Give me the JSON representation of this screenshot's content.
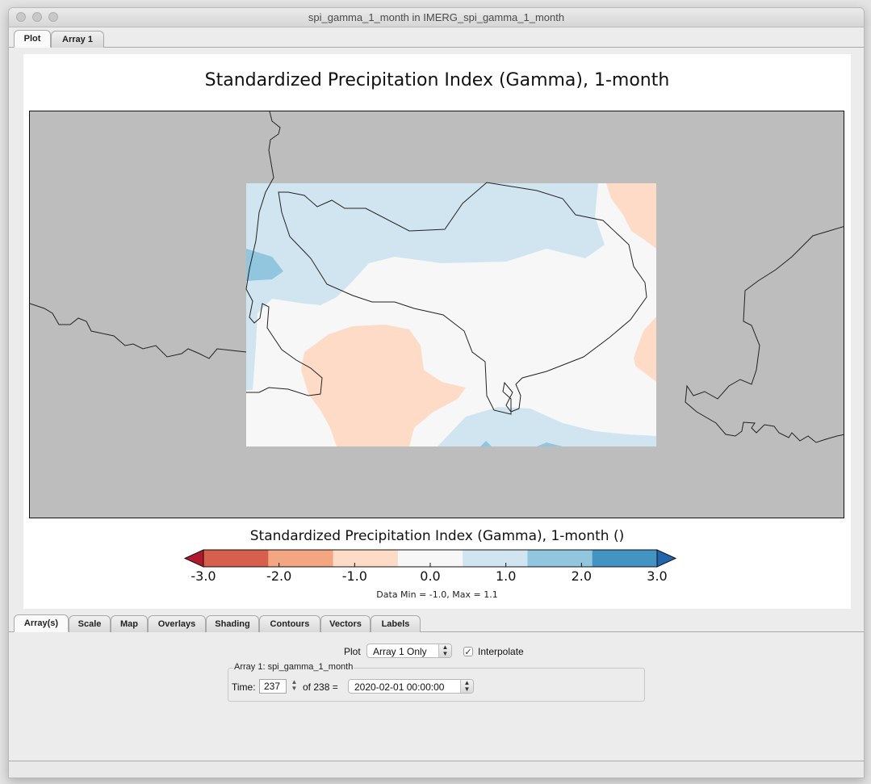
{
  "window": {
    "title": "spi_gamma_1_month in IMERG_spi_gamma_1_month"
  },
  "top_tabs": [
    {
      "label": "Plot",
      "active": true
    },
    {
      "label": "Array 1",
      "active": false
    }
  ],
  "plot": {
    "title": "Standardized Precipitation Index (Gamma), 1-month",
    "colorbar": {
      "title": "Standardized Precipitation Index (Gamma), 1-month ()",
      "ticks": [
        "-3.0",
        "-2.0",
        "-1.0",
        "0.0",
        "1.0",
        "2.0",
        "3.0"
      ],
      "colors": [
        "#b2182b",
        "#d6604d",
        "#f4a582",
        "#fddbc7",
        "#f7f7f7",
        "#d1e5f0",
        "#92c5de",
        "#4393c3",
        "#2166ac"
      ]
    },
    "data_range": "Data Min = -1.0, Max = 1.1"
  },
  "control_tabs": [
    {
      "label": "Array(s)",
      "active": true
    },
    {
      "label": "Scale"
    },
    {
      "label": "Map"
    },
    {
      "label": "Overlays"
    },
    {
      "label": "Shading"
    },
    {
      "label": "Contours"
    },
    {
      "label": "Vectors"
    },
    {
      "label": "Labels"
    }
  ],
  "controls": {
    "plot_label": "Plot",
    "plot_mode": "Array 1 Only",
    "interpolate_label": "Interpolate",
    "interpolate_checked": true,
    "array_group_title": "Array 1: spi_gamma_1_month",
    "time_label": "Time:",
    "time_index": "237",
    "time_of": "of 238 =",
    "time_value": "2020-02-01 00:00:00"
  }
}
